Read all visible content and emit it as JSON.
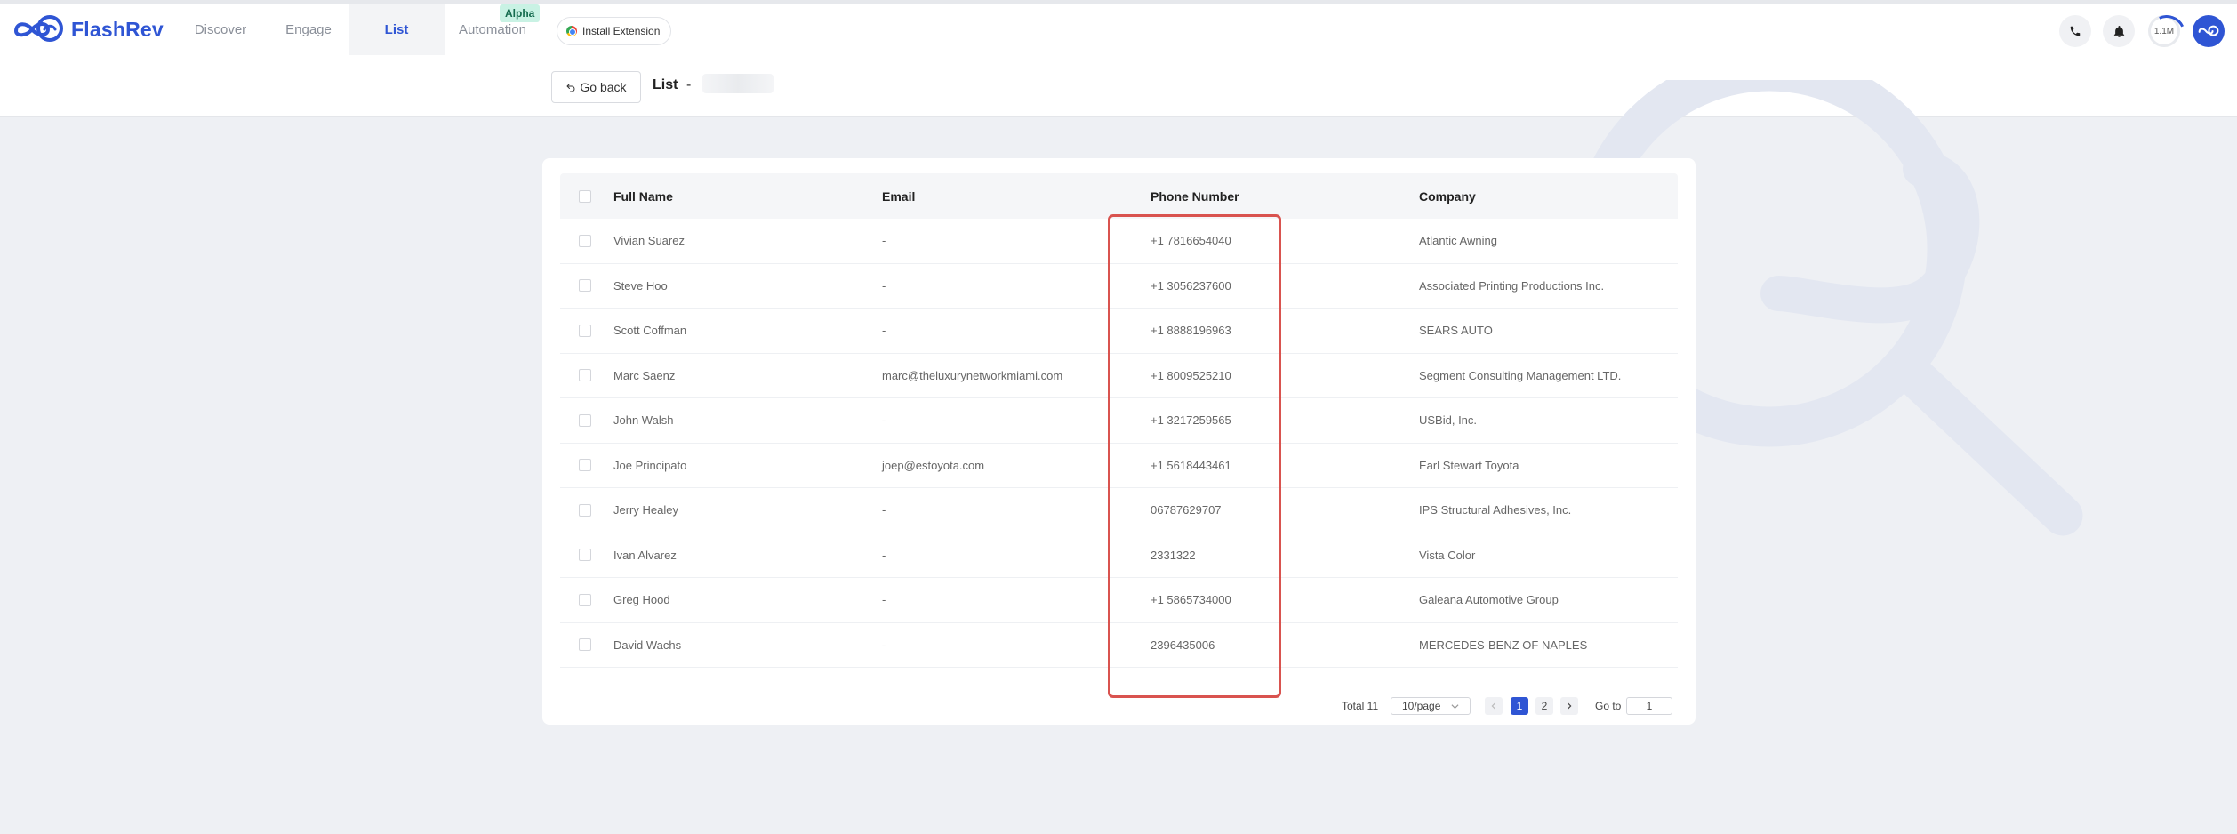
{
  "app": {
    "name": "FlashRev"
  },
  "nav": {
    "discover": "Discover",
    "engage": "Engage",
    "list": "List",
    "automation": "Automation",
    "alpha_badge": "Alpha",
    "install_extension": "Install Extension"
  },
  "header_right": {
    "credits": "1.1M"
  },
  "subheader": {
    "go_back": "Go back",
    "title": "List",
    "separator": "-"
  },
  "table": {
    "columns": [
      "Full Name",
      "Email",
      "Phone Number",
      "Company"
    ],
    "rows": [
      {
        "name": "Vivian Suarez",
        "email": "-",
        "phone": "+1 7816654040",
        "company": "Atlantic Awning"
      },
      {
        "name": "Steve Hoo",
        "email": "-",
        "phone": "+1 3056237600",
        "company": "Associated Printing Productions Inc."
      },
      {
        "name": "Scott Coffman",
        "email": "-",
        "phone": "+1 8888196963",
        "company": "SEARS AUTO"
      },
      {
        "name": "Marc Saenz",
        "email": "marc@theluxurynetworkmiami.com",
        "phone": "+1 8009525210",
        "company": "Segment Consulting Management LTD."
      },
      {
        "name": "John Walsh",
        "email": "-",
        "phone": "+1 3217259565",
        "company": "USBid, Inc."
      },
      {
        "name": "Joe Principato",
        "email": "joep@estoyota.com",
        "phone": "+1 5618443461",
        "company": "Earl Stewart Toyota"
      },
      {
        "name": "Jerry Healey",
        "email": "-",
        "phone": "06787629707",
        "company": "IPS Structural Adhesives, Inc."
      },
      {
        "name": "Ivan Alvarez",
        "email": "-",
        "phone": "2331322",
        "company": "Vista Color"
      },
      {
        "name": "Greg Hood",
        "email": "-",
        "phone": "+1 5865734000",
        "company": "Galeana Automotive Group"
      },
      {
        "name": "David Wachs",
        "email": "-",
        "phone": "2396435006",
        "company": "MERCEDES-BENZ OF NAPLES"
      }
    ]
  },
  "pagination": {
    "total": "Total 11",
    "page_size": "10/page",
    "pages": [
      "1",
      "2"
    ],
    "current_page": "1",
    "goto_label": "Go to",
    "goto_value": "1"
  },
  "colors": {
    "brand": "#2f55d4",
    "highlight": "#d9534f",
    "alpha_badge_bg": "#c9f2e4"
  }
}
